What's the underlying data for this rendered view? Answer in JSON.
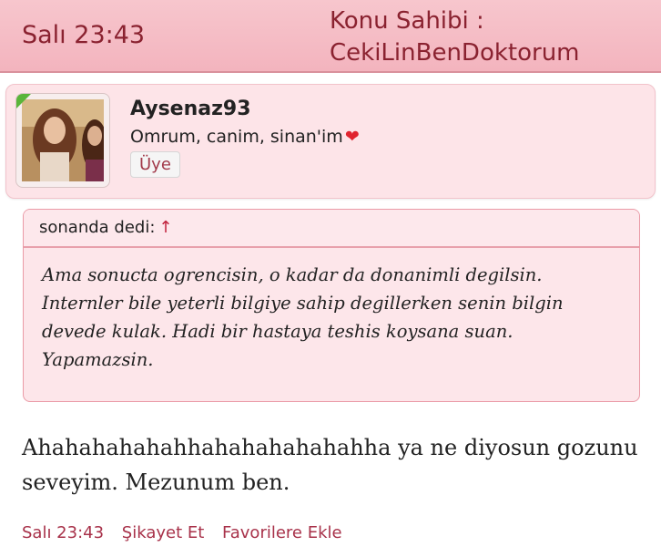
{
  "header": {
    "time": "Salı 23:43",
    "owner_line1": "Konu Sahibi :",
    "owner_line2": "CekiLinBenDoktorum"
  },
  "user": {
    "username": "Aysenaz93",
    "signature": "Omrum, canim, sinan'im",
    "signature_emoji": "❤",
    "rank": "Üye"
  },
  "quote": {
    "header": "sonanda dedi:",
    "arrow": "↑",
    "text": "Ama sonucta ogrencisin, o kadar da donanimli degilsin. Internler bile yeterli bilgiye sahip degillerken senin bilgin devede kulak. Hadi bir hastaya teshis koysana suan. Yapamazsin."
  },
  "post": {
    "text": "Ahahahahahahhahahahahahahha ya ne diyosun gozunu seveyim. Mezunum ben."
  },
  "footer": {
    "time": "Salı 23:43",
    "report": "Şikayet Et",
    "favorite": "Favorilere Ekle"
  },
  "colors": {
    "header_bg": "#f3b4be",
    "accent_text": "#8a2230",
    "card_bg": "#fde4e8",
    "link": "#a8324a"
  }
}
